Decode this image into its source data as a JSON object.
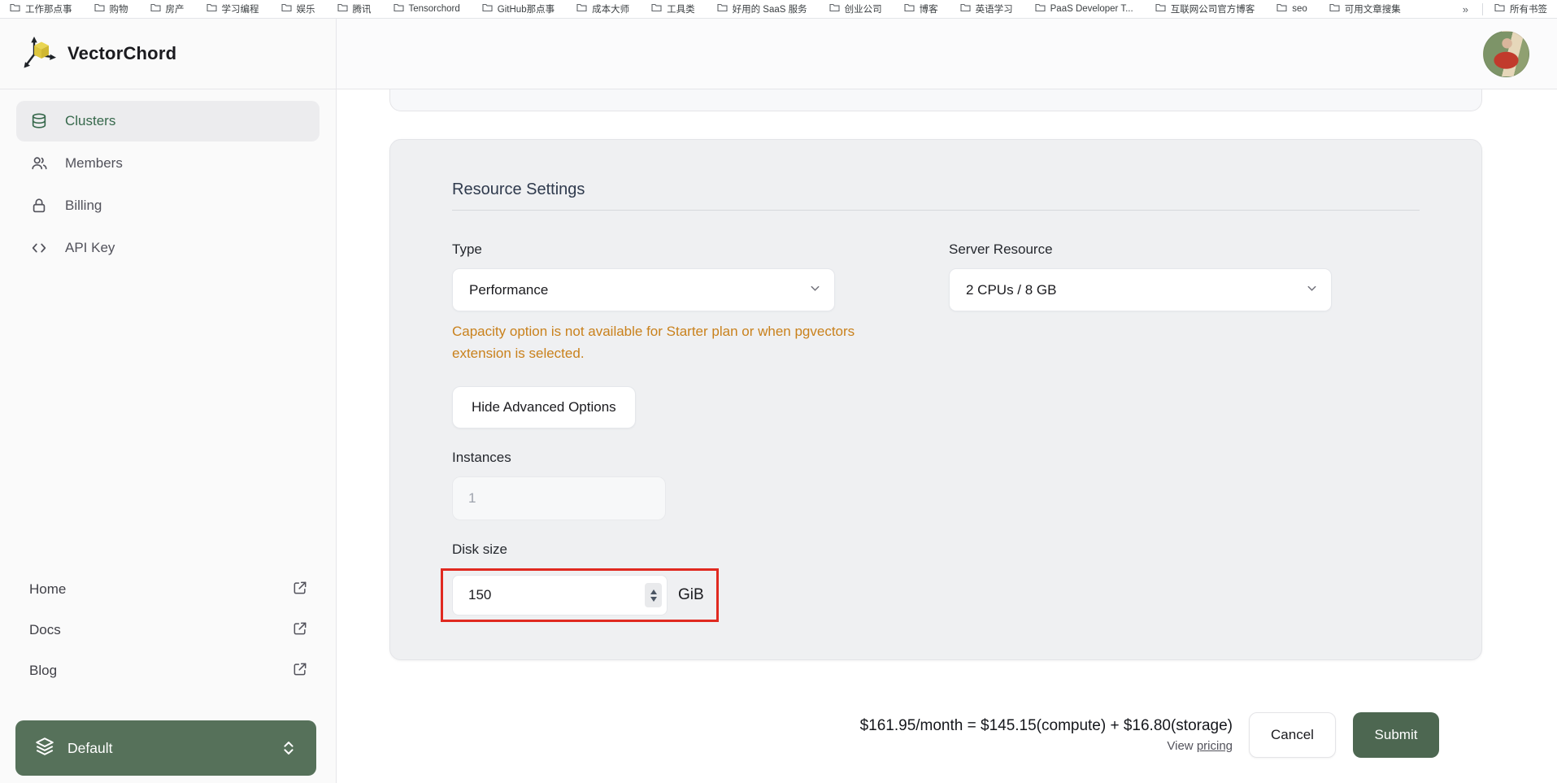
{
  "bookmarks_bar": {
    "items": [
      "工作那点事",
      "购物",
      "房产",
      "学习编程",
      "娱乐",
      "腾讯",
      "Tensorchord",
      "GitHub那点事",
      "成本大师",
      "工具类",
      "好用的 SaaS 服务",
      "创业公司",
      "博客",
      "英语学习",
      "PaaS Developer T...",
      "互联网公司官方博客",
      "seo",
      "可用文章搜集"
    ],
    "overflow_chevron": "»",
    "all_bookmarks_label": "所有书签"
  },
  "sidebar": {
    "brand": "VectorChord",
    "nav": [
      {
        "label": "Clusters",
        "icon": "database-icon",
        "active": true
      },
      {
        "label": "Members",
        "icon": "users-icon",
        "active": false
      },
      {
        "label": "Billing",
        "icon": "lock-icon",
        "active": false
      },
      {
        "label": "API Key",
        "icon": "code-icon",
        "active": false
      }
    ],
    "links": [
      {
        "label": "Home"
      },
      {
        "label": "Docs"
      },
      {
        "label": "Blog"
      }
    ],
    "project_switcher": {
      "label": "Default"
    }
  },
  "main": {
    "card_title": "Resource Settings",
    "fields": {
      "type": {
        "label": "Type",
        "value": "Performance"
      },
      "server_resource": {
        "label": "Server Resource",
        "value": "2 CPUs / 8 GB"
      },
      "warning": "Capacity option is not available for Starter plan or when pgvectors extension is selected.",
      "advanced_button": "Hide Advanced Options",
      "instances": {
        "label": "Instances",
        "placeholder": "1"
      },
      "disk_size": {
        "label": "Disk size",
        "value": "150",
        "unit": "GiB"
      }
    },
    "footer": {
      "price_summary": "$161.95/month = $145.15(compute) + $16.80(storage)",
      "view_pricing_prefix": "View ",
      "view_pricing_link": "pricing",
      "cancel_label": "Cancel",
      "submit_label": "Submit"
    }
  },
  "colors": {
    "accent_green": "#36684b",
    "project_button_green": "#56715a",
    "submit_green": "#4d6751",
    "warning_orange": "#c9811c",
    "highlight_red": "#e02920",
    "logo_yellow": "#e2cc45"
  }
}
